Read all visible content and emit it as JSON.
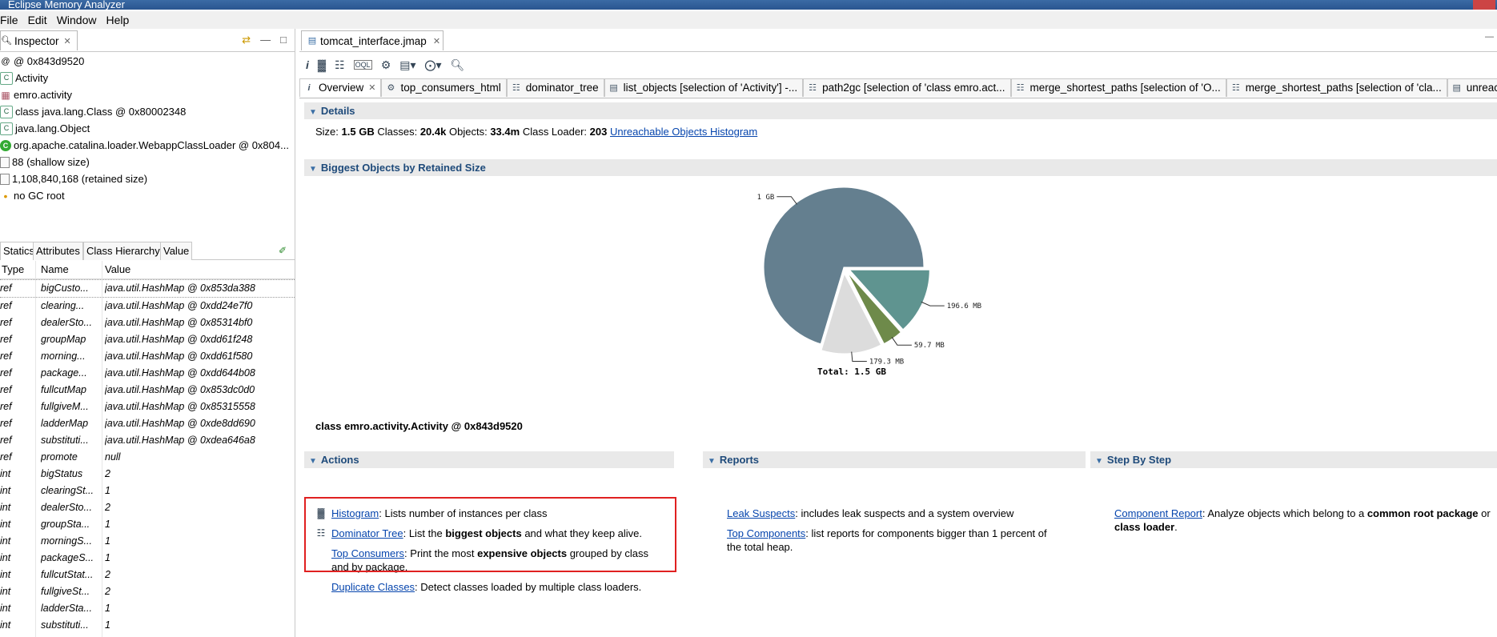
{
  "window": {
    "title": "Eclipse Memory Analyzer",
    "menu": [
      "File",
      "Edit",
      "Window",
      "Help"
    ]
  },
  "inspector": {
    "tab_label": "Inspector",
    "rows": [
      {
        "icon": "at-icon",
        "text": "@ 0x843d9520"
      },
      {
        "icon": "class-icon",
        "text": "Activity"
      },
      {
        "icon": "package-icon",
        "text": "emro.activity"
      },
      {
        "icon": "class-icon",
        "text": "class java.lang.Class @ 0x80002348"
      },
      {
        "icon": "class-icon",
        "text": "java.lang.Object"
      },
      {
        "icon": "classloader-icon",
        "text": "org.apache.catalina.loader.WebappClassLoader @ 0x804..."
      },
      {
        "icon": "document-icon",
        "text": "88 (shallow size)"
      },
      {
        "icon": "document-icon",
        "text": "1,108,840,168 (retained size)"
      },
      {
        "icon": "gc-root-icon",
        "text": "no GC root"
      }
    ],
    "subtabs": [
      "Statics",
      "Attributes",
      "Class Hierarchy",
      "Value"
    ],
    "columns": [
      "Type",
      "Name",
      "Value"
    ],
    "statics": [
      {
        "type": "ref",
        "name": "bigCusto...",
        "value": "java.util.HashMap @ 0x853da388"
      },
      {
        "type": "ref",
        "name": "clearing...",
        "value": "java.util.HashMap @ 0xdd24e7f0"
      },
      {
        "type": "ref",
        "name": "dealerSto...",
        "value": "java.util.HashMap @ 0x85314bf0"
      },
      {
        "type": "ref",
        "name": "groupMap",
        "value": "java.util.HashMap @ 0xdd61f248"
      },
      {
        "type": "ref",
        "name": "morning...",
        "value": "java.util.HashMap @ 0xdd61f580"
      },
      {
        "type": "ref",
        "name": "package...",
        "value": "java.util.HashMap @ 0xdd644b08"
      },
      {
        "type": "ref",
        "name": "fullcutMap",
        "value": "java.util.HashMap @ 0x853dc0d0"
      },
      {
        "type": "ref",
        "name": "fullgiveM...",
        "value": "java.util.HashMap @ 0x85315558"
      },
      {
        "type": "ref",
        "name": "ladderMap",
        "value": "java.util.HashMap @ 0xde8dd690"
      },
      {
        "type": "ref",
        "name": "substituti...",
        "value": "java.util.HashMap @ 0xdea646a8"
      },
      {
        "type": "ref",
        "name": "promote",
        "value": "null"
      },
      {
        "type": "int",
        "name": "bigStatus",
        "value": "2"
      },
      {
        "type": "int",
        "name": "clearingSt...",
        "value": "1"
      },
      {
        "type": "int",
        "name": "dealerSto...",
        "value": "2"
      },
      {
        "type": "int",
        "name": "groupSta...",
        "value": "1"
      },
      {
        "type": "int",
        "name": "morningS...",
        "value": "1"
      },
      {
        "type": "int",
        "name": "packageS...",
        "value": "1"
      },
      {
        "type": "int",
        "name": "fullcutStat...",
        "value": "2"
      },
      {
        "type": "int",
        "name": "fullgiveSt...",
        "value": "2"
      },
      {
        "type": "int",
        "name": "ladderSta...",
        "value": "1"
      },
      {
        "type": "int",
        "name": "substituti...",
        "value": "1"
      }
    ]
  },
  "editor": {
    "tab_label": "tomcat_interface.jmap",
    "query_tabs": [
      {
        "label": "Overview",
        "closable": true,
        "icon": "info-icon"
      },
      {
        "label": "top_consumers_html",
        "closable": false,
        "icon": "consumers-icon"
      },
      {
        "label": "dominator_tree",
        "closable": false,
        "icon": "dominator-tree-icon"
      },
      {
        "label": "list_objects [selection of 'Activity'] -...",
        "closable": false,
        "icon": "list-objects-icon"
      },
      {
        "label": "path2gc [selection of 'class emro.act...",
        "closable": false,
        "icon": "path2gc-icon"
      },
      {
        "label": "merge_shortest_paths [selection of 'O...",
        "closable": false,
        "icon": "merge-paths-icon"
      },
      {
        "label": "merge_shortest_paths [selection of 'cla...",
        "closable": false,
        "icon": "merge-paths-icon"
      },
      {
        "label": "unreachable_ob",
        "closable": false,
        "icon": "unreachable-icon"
      }
    ]
  },
  "details": {
    "heading": "Details",
    "size_label": "Size:",
    "size": "1.5 GB",
    "classes_label": "Classes:",
    "classes": "20.4k",
    "objects_label": "Objects:",
    "objects": "33.4m",
    "loader_label": "Class Loader:",
    "loader": "203",
    "histogram_link": "Unreachable Objects Histogram"
  },
  "biggest": {
    "heading": "Biggest Objects by Retained Size",
    "class_label": "class emro.activity.Activity @ 0x843d9520"
  },
  "chart_data": {
    "type": "pie",
    "title": "",
    "total_label": "Total: 1.5 GB",
    "slices": [
      {
        "label": "1 GB",
        "value": 1034.2,
        "color": "#647f8f"
      },
      {
        "label": "196.6 MB",
        "value": 196.6,
        "color": "#5f9490"
      },
      {
        "label": "59.7 MB",
        "value": 59.7,
        "color": "#6e8a4a"
      },
      {
        "label": "179.3 MB",
        "value": 179.3,
        "color": "#dcdcdc"
      }
    ]
  },
  "actions": {
    "heading": "Actions",
    "items": [
      {
        "link": "Histogram",
        "pre": ": Lists number of instances per class",
        "bold": "",
        "post": ""
      },
      {
        "link": "Dominator Tree",
        "pre": ": List the ",
        "bold": "biggest objects",
        "post": " and what they keep alive."
      },
      {
        "link": "Top Consumers",
        "pre": ": Print the most ",
        "bold": "expensive objects",
        "post": " grouped by class and by package."
      },
      {
        "link": "Duplicate Classes",
        "pre": ": Detect classes loaded by multiple class loaders.",
        "bold": "",
        "post": ""
      }
    ]
  },
  "reports": {
    "heading": "Reports",
    "items": [
      {
        "link": "Leak Suspects",
        "text": ": includes leak suspects and a system overview"
      },
      {
        "link": "Top Components",
        "text": ": list reports for components bigger than 1 percent of the total heap."
      }
    ]
  },
  "steps": {
    "heading": "Step By Step",
    "link": "Component Report",
    "pre": ": Analyze objects which belong to a ",
    "bold1": "common root package",
    "mid": " or ",
    "bold2": "class loader",
    "post": "."
  },
  "colors": {
    "highlight": "#e02020",
    "link": "#0645ad",
    "section_title": "#1e4a7a"
  }
}
